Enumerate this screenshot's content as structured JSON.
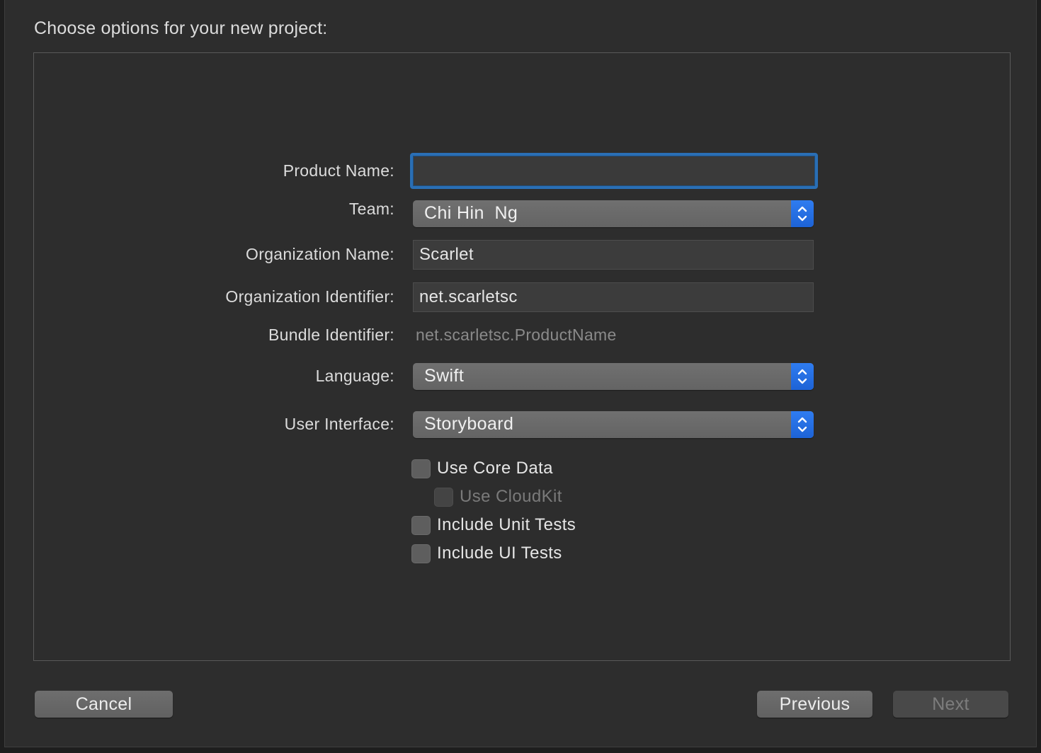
{
  "dialog": {
    "title": "Choose options for your new project:"
  },
  "form": {
    "product_name": {
      "label": "Product Name:",
      "value": ""
    },
    "team": {
      "label": "Team:",
      "value": "Chi Hin  Ng"
    },
    "organization_name": {
      "label": "Organization Name:",
      "value": "Scarlet"
    },
    "organization_identifier": {
      "label": "Organization Identifier:",
      "value": "net.scarletsc"
    },
    "bundle_identifier": {
      "label": "Bundle Identifier:",
      "value": "net.scarletsc.ProductName"
    },
    "language": {
      "label": "Language:",
      "value": "Swift"
    },
    "user_interface": {
      "label": "User Interface:",
      "value": "Storyboard"
    }
  },
  "options": [
    {
      "label": "Use Core Data",
      "checked": false,
      "enabled": true
    },
    {
      "label": "Use CloudKit",
      "checked": false,
      "enabled": false
    },
    {
      "label": "Include Unit Tests",
      "checked": false,
      "enabled": true
    },
    {
      "label": "Include UI Tests",
      "checked": false,
      "enabled": true
    }
  ],
  "buttons": {
    "cancel": "Cancel",
    "previous": "Previous",
    "next": "Next"
  },
  "icons": {
    "popup_arrows": "chevron-up-down-icon"
  },
  "colors": {
    "accent": "#1f66d9",
    "focus_ring": "#2a6fb5",
    "background": "#2d2d2d"
  }
}
